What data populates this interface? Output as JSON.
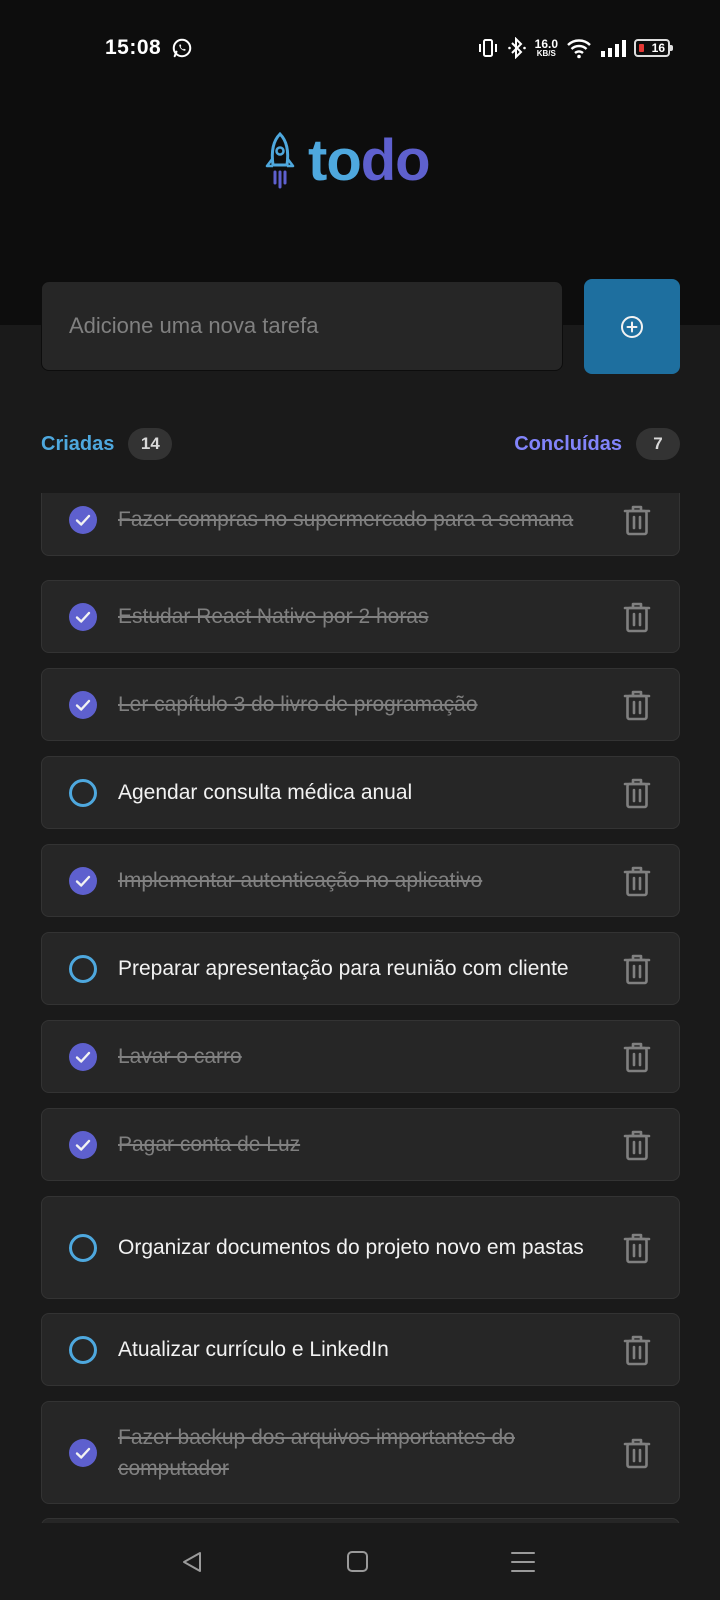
{
  "status_bar": {
    "time": "15:08",
    "net_speed_value": "16.0",
    "net_speed_unit": "KB/S",
    "battery": "16"
  },
  "logo": {
    "part1": "to",
    "part2": "do"
  },
  "new_task": {
    "placeholder": "Adicione uma nova tarefa"
  },
  "counters": {
    "created_label": "Criadas",
    "created_count": "14",
    "done_label": "Concluídas",
    "done_count": "7"
  },
  "tasks": [
    {
      "text": "Fazer compras no supermercado para a semana",
      "done": true
    },
    {
      "text": "Estudar React Native por 2 horas",
      "done": true
    },
    {
      "text": "Ler capítulo 3 do livro de programação",
      "done": true
    },
    {
      "text": "Agendar consulta médica anual",
      "done": false
    },
    {
      "text": "Implementar autenticação no aplicativo",
      "done": true
    },
    {
      "text": "Preparar apresentação para reunião com cliente",
      "done": false
    },
    {
      "text": "Lavar o carro",
      "done": true
    },
    {
      "text": "Pagar conta de Luz",
      "done": true
    },
    {
      "text": "Organizar documentos do projeto novo em pastas",
      "done": false
    },
    {
      "text": "Atualizar currículo e LinkedIn",
      "done": false
    },
    {
      "text": "Fazer backup dos arquivos importantes do computador",
      "done": true
    }
  ],
  "colors": {
    "blue": "#4ea8de",
    "purple": "#5e60ce",
    "purple_light": "#8284fa",
    "button": "#1e6f9f"
  },
  "icons": {
    "logo": "rocket-icon",
    "add": "plus-circle-icon",
    "done": "check-circle-icon",
    "pending": "empty-circle-icon",
    "delete": "trash-icon"
  }
}
